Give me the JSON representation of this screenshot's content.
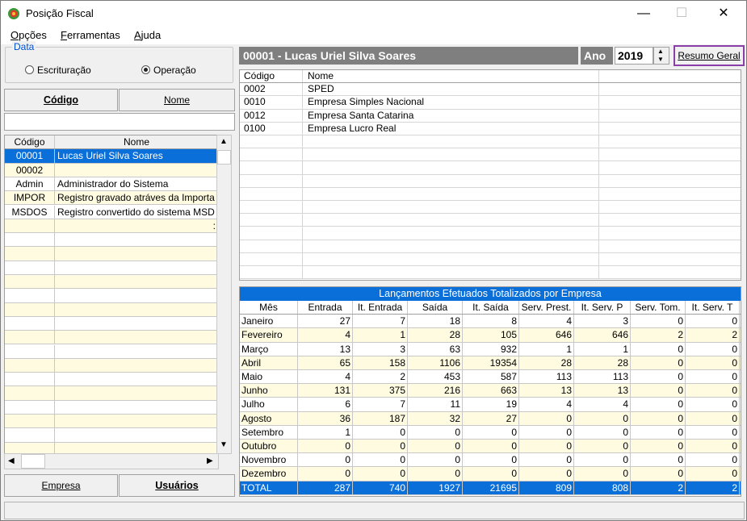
{
  "window": {
    "title": "Posição Fiscal",
    "minimize": "—",
    "maximize": "☐",
    "close": "✕"
  },
  "menu": [
    {
      "u": "O",
      "rest": "pções"
    },
    {
      "u": "F",
      "rest": "erramentas"
    },
    {
      "u": "A",
      "rest": "juda"
    }
  ],
  "data_group": {
    "legend": "Data",
    "radio1": "Escrituração",
    "radio2": "Operação",
    "selected": "Operação"
  },
  "left_tabs": {
    "codigo": "Código",
    "nome": "Nome"
  },
  "left_grid": {
    "headers": [
      "Código",
      "Nome"
    ],
    "rows": [
      [
        "00001",
        "Lucas Uriel Silva Soares"
      ],
      [
        "00002",
        ""
      ],
      [
        "Admin",
        "Administrador do Sistema"
      ],
      [
        "IMPOR",
        "Registro gravado atráves da Importa"
      ],
      [
        "MSDOS",
        "Registro convertido do sistema MSD"
      ],
      [
        "",
        ":"
      ]
    ]
  },
  "bottom_tabs": {
    "empresa": "Empresa",
    "usuarios": "Usuários"
  },
  "header": {
    "empresa": "00001 - Lucas Uriel Silva Soares",
    "ano_label": "Ano",
    "ano_value": "2019",
    "resumo": "Resumo Geral"
  },
  "top_grid": {
    "headers": [
      "Código",
      "Nome"
    ],
    "rows": [
      [
        "0002",
        "SPED"
      ],
      [
        "0010",
        "Empresa Simples Nacional"
      ],
      [
        "0012",
        "Empresa Santa Catarina"
      ],
      [
        "0100",
        "Empresa Lucro Real"
      ]
    ]
  },
  "bottom_grid": {
    "title": "Lançamentos Efetuados Totalizados por Empresa",
    "headers": [
      "Mês",
      "Entrada",
      "It. Entrada",
      "Saída",
      "It. Saída",
      "Serv. Prest.",
      "It. Serv. P",
      "Serv. Tom.",
      "It. Serv. T"
    ],
    "rows": [
      [
        "Janeiro",
        "27",
        "7",
        "18",
        "8",
        "4",
        "3",
        "0",
        "0"
      ],
      [
        "Fevereiro",
        "4",
        "1",
        "28",
        "105",
        "646",
        "646",
        "2",
        "2"
      ],
      [
        "Março",
        "13",
        "3",
        "63",
        "932",
        "1",
        "1",
        "0",
        "0"
      ],
      [
        "Abril",
        "65",
        "158",
        "1106",
        "19354",
        "28",
        "28",
        "0",
        "0"
      ],
      [
        "Maio",
        "4",
        "2",
        "453",
        "587",
        "113",
        "113",
        "0",
        "0"
      ],
      [
        "Junho",
        "131",
        "375",
        "216",
        "663",
        "13",
        "13",
        "0",
        "0"
      ],
      [
        "Julho",
        "6",
        "7",
        "11",
        "19",
        "4",
        "4",
        "0",
        "0"
      ],
      [
        "Agosto",
        "36",
        "187",
        "32",
        "27",
        "0",
        "0",
        "0",
        "0"
      ],
      [
        "Setembro",
        "1",
        "0",
        "0",
        "0",
        "0",
        "0",
        "0",
        "0"
      ],
      [
        "Outubro",
        "0",
        "0",
        "0",
        "0",
        "0",
        "0",
        "0",
        "0"
      ],
      [
        "Novembro",
        "0",
        "0",
        "0",
        "0",
        "0",
        "0",
        "0",
        "0"
      ],
      [
        "Dezembro",
        "0",
        "0",
        "0",
        "0",
        "0",
        "0",
        "0",
        "0"
      ]
    ],
    "total": [
      "TOTAL",
      "287",
      "740",
      "1927",
      "21695",
      "809",
      "808",
      "2",
      "2"
    ]
  }
}
